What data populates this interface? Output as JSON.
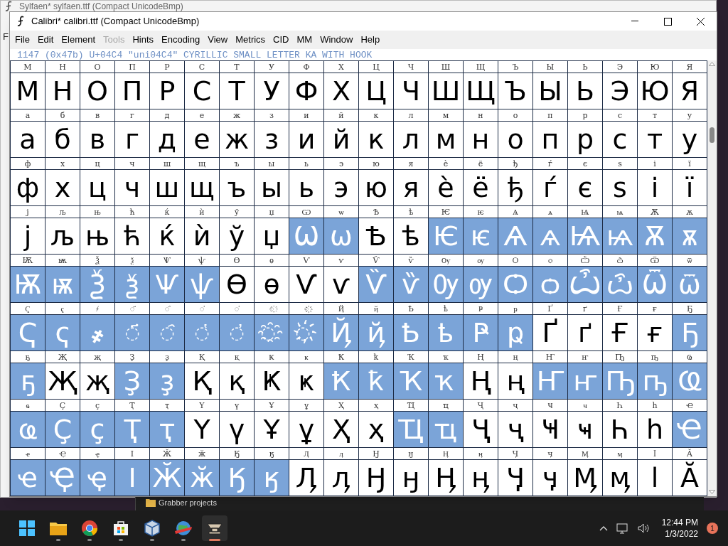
{
  "back_window": {
    "title": "Sylfaen*  sylfaen.ttf (Compact UnicodeBmp)",
    "menu_letter": "F"
  },
  "window": {
    "title": "Calibri*  calibri.ttf (Compact UnicodeBmp)"
  },
  "menu": [
    {
      "label": "File",
      "disabled": false
    },
    {
      "label": "Edit",
      "disabled": false
    },
    {
      "label": "Element",
      "disabled": false
    },
    {
      "label": "Tools",
      "disabled": true
    },
    {
      "label": "Hints",
      "disabled": false
    },
    {
      "label": "Encoding",
      "disabled": false
    },
    {
      "label": "View",
      "disabled": false
    },
    {
      "label": "Metrics",
      "disabled": false
    },
    {
      "label": "CID",
      "disabled": false
    },
    {
      "label": "MM",
      "disabled": false
    },
    {
      "label": "Window",
      "disabled": false
    },
    {
      "label": "Help",
      "disabled": false
    }
  ],
  "info_line": "1147 (0x47b) U+04C4 \"uni04C4\" CYRILLIC SMALL LETTER KA WITH HOOK",
  "rows": [
    [
      {
        "label": "М",
        "glyph": "М",
        "selected": false
      },
      {
        "label": "Н",
        "glyph": "Н",
        "selected": false
      },
      {
        "label": "О",
        "glyph": "О",
        "selected": false
      },
      {
        "label": "П",
        "glyph": "П",
        "selected": false
      },
      {
        "label": "Р",
        "glyph": "Р",
        "selected": false
      },
      {
        "label": "С",
        "glyph": "С",
        "selected": false
      },
      {
        "label": "Т",
        "glyph": "Т",
        "selected": false
      },
      {
        "label": "У",
        "glyph": "У",
        "selected": false
      },
      {
        "label": "Ф",
        "glyph": "Ф",
        "selected": false
      },
      {
        "label": "Х",
        "glyph": "Х",
        "selected": false
      },
      {
        "label": "Ц",
        "glyph": "Ц",
        "selected": false
      },
      {
        "label": "Ч",
        "glyph": "Ч",
        "selected": false
      },
      {
        "label": "Ш",
        "glyph": "Ш",
        "selected": false
      },
      {
        "label": "Щ",
        "glyph": "Щ",
        "selected": false
      },
      {
        "label": "Ъ",
        "glyph": "Ъ",
        "selected": false
      },
      {
        "label": "Ы",
        "glyph": "Ы",
        "selected": false
      },
      {
        "label": "Ь",
        "glyph": "Ь",
        "selected": false
      },
      {
        "label": "Э",
        "glyph": "Э",
        "selected": false
      },
      {
        "label": "Ю",
        "glyph": "Ю",
        "selected": false
      },
      {
        "label": "Я",
        "glyph": "Я",
        "selected": false
      }
    ],
    [
      {
        "label": "а",
        "glyph": "а",
        "selected": false
      },
      {
        "label": "б",
        "glyph": "б",
        "selected": false
      },
      {
        "label": "в",
        "glyph": "в",
        "selected": false
      },
      {
        "label": "г",
        "glyph": "г",
        "selected": false
      },
      {
        "label": "д",
        "glyph": "д",
        "selected": false
      },
      {
        "label": "е",
        "glyph": "е",
        "selected": false
      },
      {
        "label": "ж",
        "glyph": "ж",
        "selected": false
      },
      {
        "label": "з",
        "glyph": "з",
        "selected": false
      },
      {
        "label": "и",
        "glyph": "и",
        "selected": false
      },
      {
        "label": "й",
        "glyph": "й",
        "selected": false
      },
      {
        "label": "к",
        "glyph": "к",
        "selected": false
      },
      {
        "label": "л",
        "glyph": "л",
        "selected": false
      },
      {
        "label": "м",
        "glyph": "м",
        "selected": false
      },
      {
        "label": "н",
        "glyph": "н",
        "selected": false
      },
      {
        "label": "о",
        "glyph": "о",
        "selected": false
      },
      {
        "label": "п",
        "glyph": "п",
        "selected": false
      },
      {
        "label": "р",
        "glyph": "р",
        "selected": false
      },
      {
        "label": "с",
        "glyph": "с",
        "selected": false
      },
      {
        "label": "т",
        "glyph": "т",
        "selected": false
      },
      {
        "label": "у",
        "glyph": "у",
        "selected": false
      }
    ],
    [
      {
        "label": "ф",
        "glyph": "ф",
        "selected": false
      },
      {
        "label": "х",
        "glyph": "х",
        "selected": false
      },
      {
        "label": "ц",
        "glyph": "ц",
        "selected": false
      },
      {
        "label": "ч",
        "glyph": "ч",
        "selected": false
      },
      {
        "label": "ш",
        "glyph": "ш",
        "selected": false
      },
      {
        "label": "щ",
        "glyph": "щ",
        "selected": false
      },
      {
        "label": "ъ",
        "glyph": "ъ",
        "selected": false
      },
      {
        "label": "ы",
        "glyph": "ы",
        "selected": false
      },
      {
        "label": "ь",
        "glyph": "ь",
        "selected": false
      },
      {
        "label": "э",
        "glyph": "э",
        "selected": false
      },
      {
        "label": "ю",
        "glyph": "ю",
        "selected": false
      },
      {
        "label": "я",
        "glyph": "я",
        "selected": false
      },
      {
        "label": "ѐ",
        "glyph": "ѐ",
        "selected": false
      },
      {
        "label": "ё",
        "glyph": "ё",
        "selected": false
      },
      {
        "label": "ђ",
        "glyph": "ђ",
        "selected": false
      },
      {
        "label": "ѓ",
        "glyph": "ѓ",
        "selected": false
      },
      {
        "label": "є",
        "glyph": "є",
        "selected": false
      },
      {
        "label": "ѕ",
        "glyph": "ѕ",
        "selected": false
      },
      {
        "label": "і",
        "glyph": "і",
        "selected": false
      },
      {
        "label": "ї",
        "glyph": "ї",
        "selected": false
      }
    ],
    [
      {
        "label": "ј",
        "glyph": "ј",
        "selected": false
      },
      {
        "label": "љ",
        "glyph": "љ",
        "selected": false
      },
      {
        "label": "њ",
        "glyph": "њ",
        "selected": false
      },
      {
        "label": "ћ",
        "glyph": "ћ",
        "selected": false
      },
      {
        "label": "ќ",
        "glyph": "ќ",
        "selected": false
      },
      {
        "label": "ѝ",
        "glyph": "ѝ",
        "selected": false
      },
      {
        "label": "ў",
        "glyph": "ў",
        "selected": false
      },
      {
        "label": "џ",
        "glyph": "џ",
        "selected": false
      },
      {
        "label": "Ѡ",
        "glyph": "Ѡ",
        "selected": true
      },
      {
        "label": "ѡ",
        "glyph": "ѡ",
        "selected": true
      },
      {
        "label": "Ѣ",
        "glyph": "Ѣ",
        "selected": false
      },
      {
        "label": "ѣ",
        "glyph": "ѣ",
        "selected": false
      },
      {
        "label": "Ѥ",
        "glyph": "Ѥ",
        "selected": true
      },
      {
        "label": "ѥ",
        "glyph": "ѥ",
        "selected": true
      },
      {
        "label": "Ѧ",
        "glyph": "Ѧ",
        "selected": true
      },
      {
        "label": "ѧ",
        "glyph": "ѧ",
        "selected": true
      },
      {
        "label": "Ѩ",
        "glyph": "Ѩ",
        "selected": true
      },
      {
        "label": "ѩ",
        "glyph": "ѩ",
        "selected": true
      },
      {
        "label": "Ѫ",
        "glyph": "Ѫ",
        "selected": true
      },
      {
        "label": "ѫ",
        "glyph": "ѫ",
        "selected": true
      }
    ],
    [
      {
        "label": "Ѭ",
        "glyph": "Ѭ",
        "selected": true
      },
      {
        "label": "ѭ",
        "glyph": "ѭ",
        "selected": true
      },
      {
        "label": "Ѯ",
        "glyph": "Ѯ",
        "selected": true
      },
      {
        "label": "ѯ",
        "glyph": "ѯ",
        "selected": true
      },
      {
        "label": "Ѱ",
        "glyph": "Ѱ",
        "selected": true
      },
      {
        "label": "ѱ",
        "glyph": "ѱ",
        "selected": true
      },
      {
        "label": "Ѳ",
        "glyph": "Ѳ",
        "selected": false
      },
      {
        "label": "ѳ",
        "glyph": "ѳ",
        "selected": false
      },
      {
        "label": "Ѵ",
        "glyph": "Ѵ",
        "selected": false
      },
      {
        "label": "ѵ",
        "glyph": "ѵ",
        "selected": false
      },
      {
        "label": "Ѷ",
        "glyph": "Ѷ",
        "selected": true
      },
      {
        "label": "ѷ",
        "glyph": "ѷ",
        "selected": true
      },
      {
        "label": "Ѹ",
        "glyph": "Ѹ",
        "selected": true
      },
      {
        "label": "ѹ",
        "glyph": "ѹ",
        "selected": true
      },
      {
        "label": "Ѻ",
        "glyph": "Ѻ",
        "selected": true
      },
      {
        "label": "ѻ",
        "glyph": "ѻ",
        "selected": true
      },
      {
        "label": "Ѽ",
        "glyph": "Ѽ",
        "selected": true
      },
      {
        "label": "ѽ",
        "glyph": "ѽ",
        "selected": true
      },
      {
        "label": "Ѿ",
        "glyph": "Ѿ",
        "selected": true
      },
      {
        "label": "ѿ",
        "glyph": "ѿ",
        "selected": true
      }
    ],
    [
      {
        "label": "Ҁ",
        "glyph": "Ҁ",
        "selected": true
      },
      {
        "label": "ҁ",
        "glyph": "ҁ",
        "selected": true
      },
      {
        "label": "҂",
        "glyph": "҂",
        "selected": true
      },
      {
        "label": "◌҃",
        "glyph": "◌҃",
        "selected": true,
        "kind": "mark"
      },
      {
        "label": "◌҄",
        "glyph": "◌҄",
        "selected": true,
        "kind": "mark"
      },
      {
        "label": "◌҅",
        "glyph": "◌҅",
        "selected": true,
        "kind": "mark"
      },
      {
        "label": "◌҆",
        "glyph": "◌҆",
        "selected": true,
        "kind": "mark"
      },
      {
        "label": "◌҈",
        "glyph": "◌҈",
        "selected": true,
        "kind": "mark"
      },
      {
        "label": "◌҉",
        "glyph": "◌҉",
        "selected": true,
        "kind": "mark"
      },
      {
        "label": "Ҋ",
        "glyph": "Ҋ",
        "selected": true
      },
      {
        "label": "ҋ",
        "glyph": "ҋ",
        "selected": true
      },
      {
        "label": "Ҍ",
        "glyph": "Ҍ",
        "selected": true
      },
      {
        "label": "ҍ",
        "glyph": "ҍ",
        "selected": true
      },
      {
        "label": "Ҏ",
        "glyph": "Ҏ",
        "selected": true
      },
      {
        "label": "ҏ",
        "glyph": "ҏ",
        "selected": true
      },
      {
        "label": "Ґ",
        "glyph": "Ґ",
        "selected": false
      },
      {
        "label": "ґ",
        "glyph": "ґ",
        "selected": false
      },
      {
        "label": "Ғ",
        "glyph": "Ғ",
        "selected": false
      },
      {
        "label": "ғ",
        "glyph": "ғ",
        "selected": false
      },
      {
        "label": "Ҕ",
        "glyph": "Ҕ",
        "selected": true
      }
    ],
    [
      {
        "label": "ҕ",
        "glyph": "ҕ",
        "selected": true
      },
      {
        "label": "Җ",
        "glyph": "Җ",
        "selected": false
      },
      {
        "label": "җ",
        "glyph": "җ",
        "selected": false
      },
      {
        "label": "Ҙ",
        "glyph": "Ҙ",
        "selected": true
      },
      {
        "label": "ҙ",
        "glyph": "ҙ",
        "selected": true
      },
      {
        "label": "Қ",
        "glyph": "Қ",
        "selected": false
      },
      {
        "label": "қ",
        "glyph": "қ",
        "selected": false
      },
      {
        "label": "Ҝ",
        "glyph": "Ҝ",
        "selected": false
      },
      {
        "label": "ҝ",
        "glyph": "ҝ",
        "selected": false
      },
      {
        "label": "Ҟ",
        "glyph": "Ҟ",
        "selected": true
      },
      {
        "label": "ҟ",
        "glyph": "ҟ",
        "selected": true
      },
      {
        "label": "Ҡ",
        "glyph": "Ҡ",
        "selected": true
      },
      {
        "label": "ҡ",
        "glyph": "ҡ",
        "selected": true
      },
      {
        "label": "Ң",
        "glyph": "Ң",
        "selected": false
      },
      {
        "label": "ң",
        "glyph": "ң",
        "selected": false
      },
      {
        "label": "Ҥ",
        "glyph": "Ҥ",
        "selected": true
      },
      {
        "label": "ҥ",
        "glyph": "ҥ",
        "selected": true
      },
      {
        "label": "Ҧ",
        "glyph": "Ҧ",
        "selected": true
      },
      {
        "label": "ҧ",
        "glyph": "ҧ",
        "selected": true
      },
      {
        "label": "Ҩ",
        "glyph": "Ҩ",
        "selected": true
      }
    ],
    [
      {
        "label": "ҩ",
        "glyph": "ҩ",
        "selected": true
      },
      {
        "label": "Ҫ",
        "glyph": "Ҫ",
        "selected": true
      },
      {
        "label": "ҫ",
        "glyph": "ҫ",
        "selected": true
      },
      {
        "label": "Ҭ",
        "glyph": "Ҭ",
        "selected": true
      },
      {
        "label": "ҭ",
        "glyph": "ҭ",
        "selected": true
      },
      {
        "label": "Ү",
        "glyph": "Ү",
        "selected": false
      },
      {
        "label": "ү",
        "glyph": "ү",
        "selected": false
      },
      {
        "label": "Ұ",
        "glyph": "Ұ",
        "selected": false
      },
      {
        "label": "ұ",
        "glyph": "ұ",
        "selected": false
      },
      {
        "label": "Ҳ",
        "glyph": "Ҳ",
        "selected": false
      },
      {
        "label": "ҳ",
        "glyph": "ҳ",
        "selected": false
      },
      {
        "label": "Ҵ",
        "glyph": "Ҵ",
        "selected": true
      },
      {
        "label": "ҵ",
        "glyph": "ҵ",
        "selected": true
      },
      {
        "label": "Ҷ",
        "glyph": "Ҷ",
        "selected": false
      },
      {
        "label": "ҷ",
        "glyph": "ҷ",
        "selected": false
      },
      {
        "label": "Ҹ",
        "glyph": "Ҹ",
        "selected": false
      },
      {
        "label": "ҹ",
        "glyph": "ҹ",
        "selected": false
      },
      {
        "label": "Һ",
        "glyph": "Һ",
        "selected": false
      },
      {
        "label": "һ",
        "glyph": "һ",
        "selected": false
      },
      {
        "label": "Ҽ",
        "glyph": "Ҽ",
        "selected": true
      }
    ],
    [
      {
        "label": "ҽ",
        "glyph": "ҽ",
        "selected": true
      },
      {
        "label": "Ҿ",
        "glyph": "Ҿ",
        "selected": true
      },
      {
        "label": "ҿ",
        "glyph": "ҿ",
        "selected": true
      },
      {
        "label": "Ӏ",
        "glyph": "Ӏ",
        "selected": true
      },
      {
        "label": "Ӂ",
        "glyph": "Ӂ",
        "selected": true
      },
      {
        "label": "ӂ",
        "glyph": "ӂ",
        "selected": true
      },
      {
        "label": "Ӄ",
        "glyph": "Ӄ",
        "selected": true
      },
      {
        "label": "ӄ",
        "glyph": "ӄ",
        "selected": true
      },
      {
        "label": "Ӆ",
        "glyph": "Ӆ",
        "selected": false
      },
      {
        "label": "ӆ",
        "glyph": "ӆ",
        "selected": false
      },
      {
        "label": "Ӈ",
        "glyph": "Ӈ",
        "selected": false
      },
      {
        "label": "ӈ",
        "glyph": "ӈ",
        "selected": false
      },
      {
        "label": "Ӊ",
        "glyph": "Ӊ",
        "selected": false
      },
      {
        "label": "ӊ",
        "glyph": "ӊ",
        "selected": false
      },
      {
        "label": "Ӌ",
        "glyph": "Ӌ",
        "selected": false
      },
      {
        "label": "ӌ",
        "glyph": "ӌ",
        "selected": false
      },
      {
        "label": "Ӎ",
        "glyph": "Ӎ",
        "selected": false
      },
      {
        "label": "ӎ",
        "glyph": "ӎ",
        "selected": false
      },
      {
        "label": "ӏ",
        "glyph": "ӏ",
        "selected": false
      },
      {
        "label": "Ӑ",
        "glyph": "Ӑ",
        "selected": false
      }
    ]
  ],
  "explorer_item": "Grabber projects",
  "taskbar": {
    "apps": [
      {
        "kind": "start",
        "active": false
      },
      {
        "kind": "folder",
        "active": false
      },
      {
        "kind": "chrome",
        "active": false
      },
      {
        "kind": "store",
        "active": false
      },
      {
        "kind": "cube",
        "active": false
      },
      {
        "kind": "globe",
        "active": false
      },
      {
        "kind": "fontforge",
        "active": true
      }
    ],
    "time": "12:44 PM",
    "date": "1/3/2022",
    "badge": "1"
  }
}
